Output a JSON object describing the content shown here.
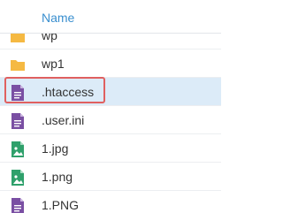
{
  "header": {
    "name_column": "Name"
  },
  "files": [
    {
      "name": "wp",
      "type": "folder",
      "icon": "folder-icon",
      "selected": false
    },
    {
      "name": "wp1",
      "type": "folder",
      "icon": "folder-icon",
      "selected": false
    },
    {
      "name": ".htaccess",
      "type": "file",
      "icon": "document-icon",
      "selected": true,
      "highlighted": true
    },
    {
      "name": ".user.ini",
      "type": "file",
      "icon": "document-icon",
      "selected": false
    },
    {
      "name": "1.jpg",
      "type": "image",
      "icon": "image-file-icon",
      "selected": false
    },
    {
      "name": "1.png",
      "type": "image",
      "icon": "image-file-icon",
      "selected": false
    },
    {
      "name": "1.PNG",
      "type": "file",
      "icon": "document-icon",
      "selected": false
    }
  ],
  "colors": {
    "header_text": "#3a8fcf",
    "folder": "#f5b942",
    "document": "#7a4fa3",
    "image_file": "#2fa06b",
    "selected_row": "#dcebf8",
    "highlight_border": "#e06060"
  }
}
